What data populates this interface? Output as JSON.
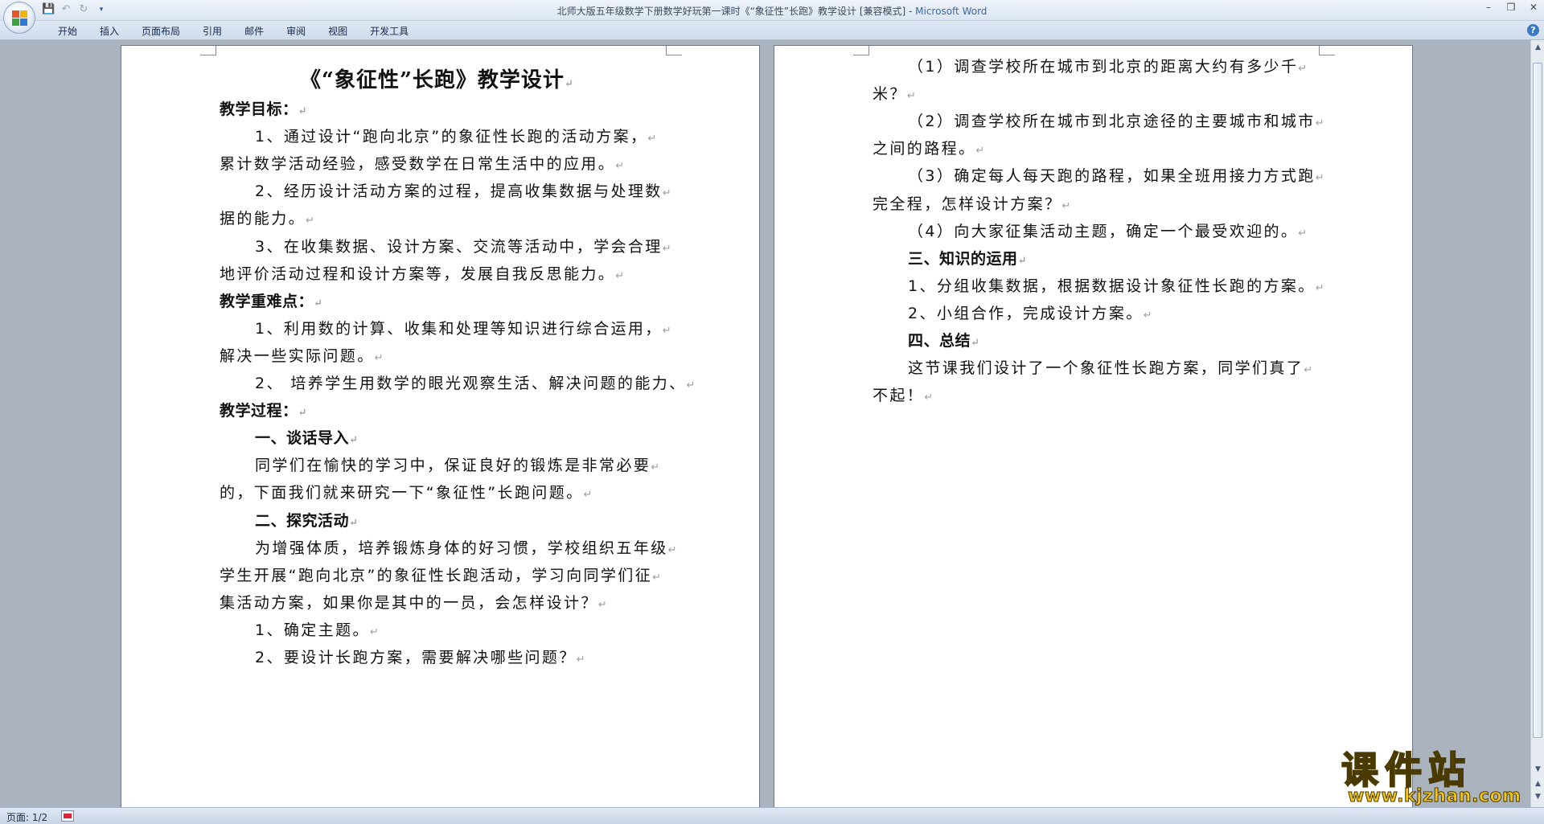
{
  "window": {
    "title": "北师大版五年级数学下册数学好玩第一课时《“象征性”长跑》教学设计 [兼容模式] - ",
    "app_name": "Microsoft Word"
  },
  "ribbon": {
    "tabs": [
      "开始",
      "插入",
      "页面布局",
      "引用",
      "邮件",
      "审阅",
      "视图",
      "开发工具"
    ]
  },
  "document": {
    "title": "《“象征性”长跑》教学设计",
    "left_page": [
      {
        "text": "教学目标：",
        "kind": "heading",
        "indent": 0
      },
      {
        "text": "1、通过设计“跑向北京”的象征性长跑的活动方案，",
        "kind": "body",
        "indent": 1
      },
      {
        "text": "累计数学活动经验，感受数学在日常生活中的应用。",
        "kind": "body",
        "indent": 0
      },
      {
        "text": "2、经历设计活动方案的过程，提高收集数据与处理数",
        "kind": "body",
        "indent": 1
      },
      {
        "text": "据的能力。",
        "kind": "body",
        "indent": 0
      },
      {
        "text": "3、在收集数据、设计方案、交流等活动中，学会合理",
        "kind": "body",
        "indent": 1
      },
      {
        "text": "地评价活动过程和设计方案等，发展自我反思能力。",
        "kind": "body",
        "indent": 0
      },
      {
        "text": "教学重难点：",
        "kind": "heading",
        "indent": 0
      },
      {
        "text": "1、利用数的计算、收集和处理等知识进行综合运用，",
        "kind": "body",
        "indent": 1
      },
      {
        "text": "解决一些实际问题。",
        "kind": "body",
        "indent": 0
      },
      {
        "text": "2、 培养学生用数学的眼光观察生活、解决问题的能力、",
        "kind": "body",
        "indent": 1
      },
      {
        "text": "教学过程：",
        "kind": "heading",
        "indent": 0
      },
      {
        "text": "一、谈话导入",
        "kind": "heading",
        "indent": 1
      },
      {
        "text": "同学们在愉快的学习中，保证良好的锻炼是非常必要",
        "kind": "body",
        "indent": 1
      },
      {
        "text": "的，下面我们就来研究一下“象征性”长跑问题。",
        "kind": "body",
        "indent": 0
      },
      {
        "text": "二、探究活动",
        "kind": "heading",
        "indent": 1
      },
      {
        "text": "为增强体质，培养锻炼身体的好习惯，学校组织五年级",
        "kind": "body",
        "indent": 1
      },
      {
        "text": "学生开展“跑向北京”的象征性长跑活动，学习向同学们征",
        "kind": "body",
        "indent": 0
      },
      {
        "text": "集活动方案，如果你是其中的一员，会怎样设计？",
        "kind": "body",
        "indent": 0
      },
      {
        "text": "1、确定主题。",
        "kind": "body",
        "indent": 1
      },
      {
        "text": "2、要设计长跑方案，需要解决哪些问题？",
        "kind": "body",
        "indent": 1
      }
    ],
    "right_page": [
      {
        "text": "（1）调查学校所在城市到北京的距离大约有多少千",
        "kind": "body",
        "indent": 1
      },
      {
        "text": "米？",
        "kind": "body",
        "indent": 0
      },
      {
        "text": "（2）调查学校所在城市到北京途径的主要城市和城市",
        "kind": "body",
        "indent": 1
      },
      {
        "text": "之间的路程。",
        "kind": "body",
        "indent": 0
      },
      {
        "text": "（3）确定每人每天跑的路程，如果全班用接力方式跑",
        "kind": "body",
        "indent": 1
      },
      {
        "text": "完全程，怎样设计方案？",
        "kind": "body",
        "indent": 0
      },
      {
        "text": "（4）向大家征集活动主题，确定一个最受欢迎的。",
        "kind": "body",
        "indent": 1
      },
      {
        "text": "三、知识的运用",
        "kind": "heading",
        "indent": 1
      },
      {
        "text": "1、分组收集数据，根据数据设计象征性长跑的方案。",
        "kind": "body",
        "indent": 1
      },
      {
        "text": "2、小组合作，完成设计方案。",
        "kind": "body",
        "indent": 1
      },
      {
        "text": "四、总结",
        "kind": "heading",
        "indent": 1
      },
      {
        "text": "这节课我们设计了一个象征性长跑方案，同学们真了",
        "kind": "body",
        "indent": 1
      },
      {
        "text": "不起！",
        "kind": "body",
        "indent": 0
      }
    ],
    "paragraph_mark": "↵"
  },
  "status": {
    "page": "页面: 1/2"
  },
  "watermark": {
    "main": "课件站",
    "url": "www.kjzhan.com"
  },
  "icons": {
    "office_button": "office-logo-icon",
    "save": "save-icon",
    "undo": "undo-icon",
    "redo": "redo-icon",
    "customize": "customize-qat-icon",
    "help": "help-icon"
  },
  "colors": {
    "title_app": "#3a66b0",
    "watermark": "#f2c618"
  }
}
